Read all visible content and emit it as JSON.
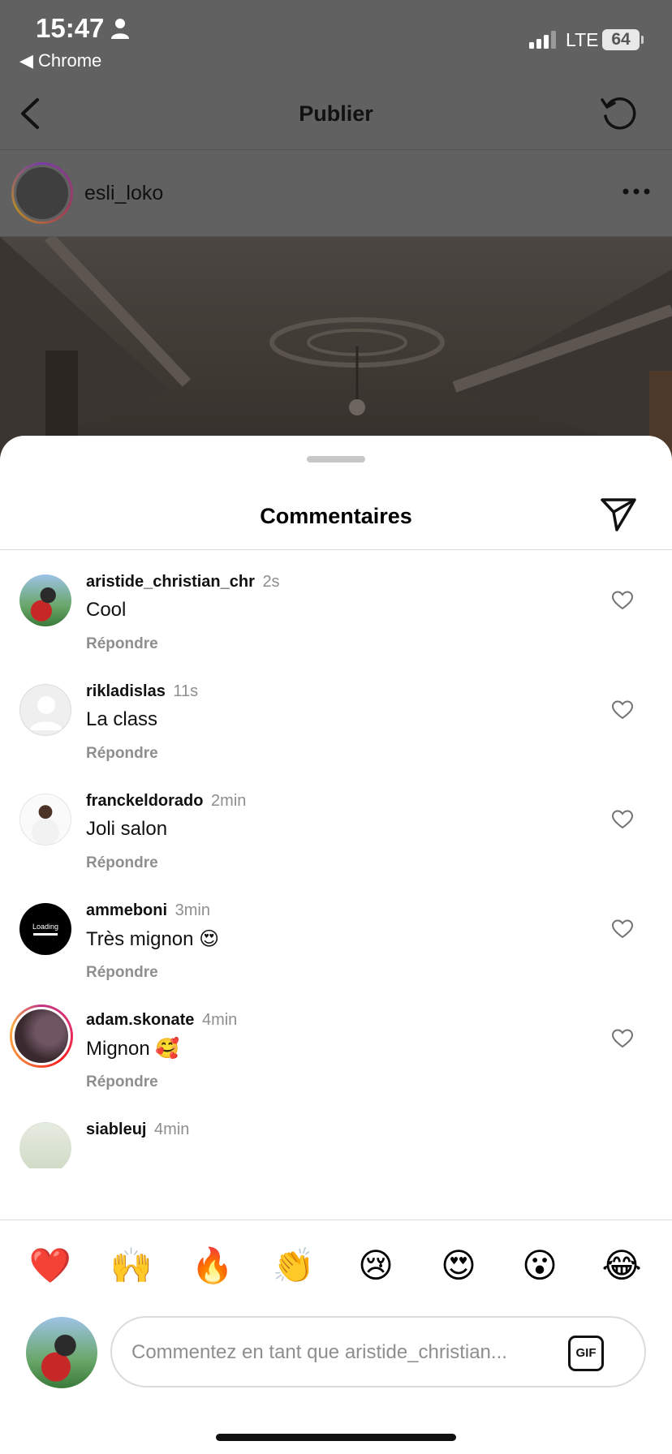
{
  "status_bar": {
    "time": "15:47",
    "back_app": "◀ Chrome",
    "network": "LTE",
    "battery": "64"
  },
  "nav": {
    "title": "Publier"
  },
  "post": {
    "username": "esli_loko"
  },
  "sheet": {
    "title": "Commentaires"
  },
  "comments": [
    {
      "user": "aristide_christian_chr",
      "age": "2s",
      "text": "Cool",
      "reply": "Répondre"
    },
    {
      "user": "rikladislas",
      "age": "11s",
      "text": "La class",
      "reply": "Répondre"
    },
    {
      "user": "franckeldorado",
      "age": "2min",
      "text": "Joli salon",
      "reply": "Répondre"
    },
    {
      "user": "ammeboni",
      "age": "3min",
      "text": "Très mignon 😍",
      "reply": "Répondre",
      "avatar_text": "Loading"
    },
    {
      "user": "adam.skonate",
      "age": "4min",
      "text": "Mignon 🥰",
      "reply": "Répondre"
    },
    {
      "user": "siableuj",
      "age": "4min",
      "text": "",
      "reply": ""
    }
  ],
  "quick_emojis": [
    "❤️",
    "🙌",
    "🔥",
    "👏",
    "😢",
    "😍",
    "😮",
    "😂"
  ],
  "composer": {
    "placeholder": "Commentez en tant que aristide_christian...",
    "gif_label": "GIF"
  },
  "colors": {
    "accent_text": "#111111",
    "muted_text": "#8e8e8e",
    "divider": "#dbdbdb",
    "dim_overlay": "#616161"
  }
}
